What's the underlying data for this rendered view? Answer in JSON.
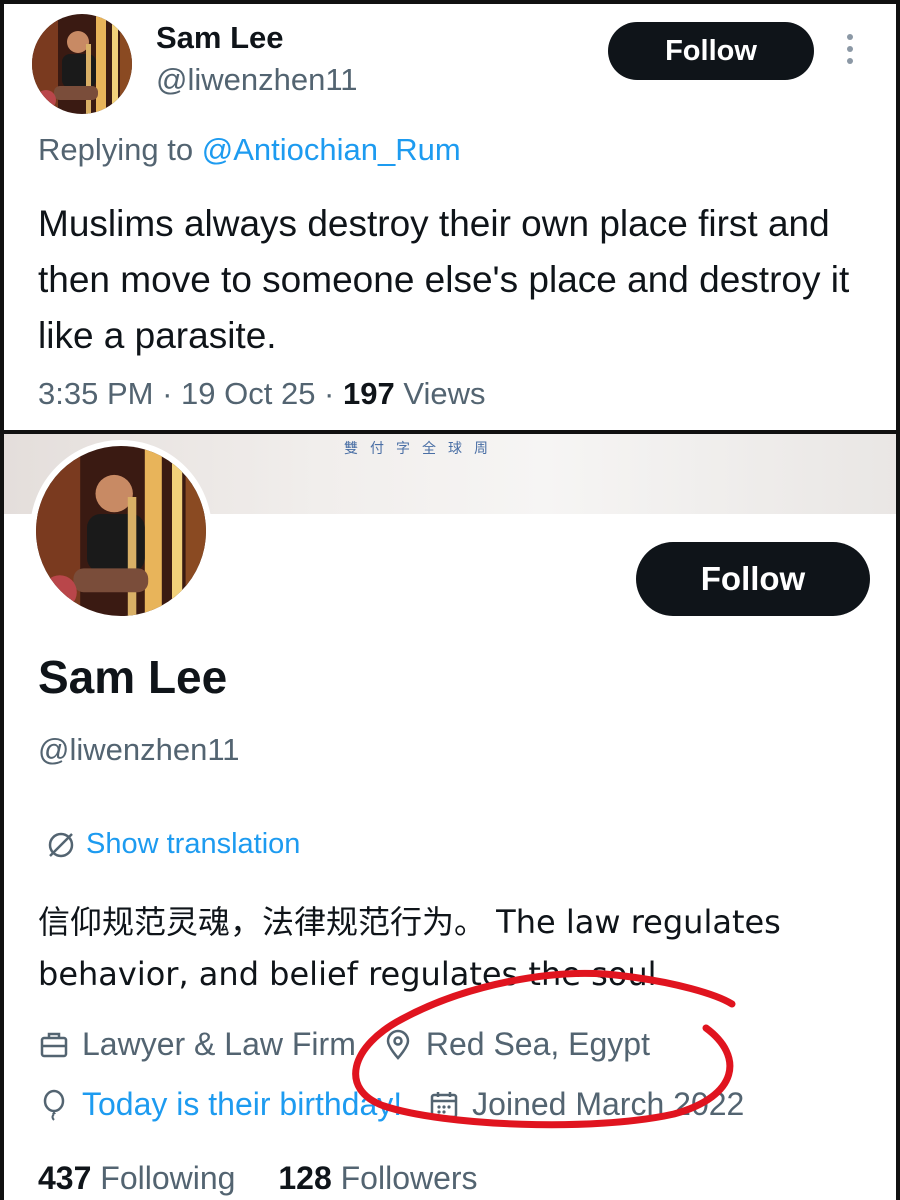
{
  "tweet": {
    "author_name": "Sam Lee",
    "author_handle": "@liwenzhen11",
    "follow_label": "Follow",
    "reply_prefix": "Replying to",
    "reply_mention": "@Antiochian_Rum",
    "text": "Muslims always destroy their own place first and then move to someone else's place and destroy it like a parasite.",
    "time": "3:35 PM",
    "separator": " · ",
    "date": "19 Oct 25",
    "views_count": "197",
    "views_label": "Views"
  },
  "profile": {
    "banner_text": "雙付字全球周",
    "name": "Sam Lee",
    "handle": "@liwenzhen11",
    "follow_label": "Follow",
    "show_translation": "Show translation",
    "bio": "信仰规范灵魂，法律规范行为。 The law regulates behavior, and belief regulates the soul.",
    "category": "Lawyer & Law Firm",
    "location": "Red Sea, Egypt",
    "birthday": "Today is their birthday!",
    "joined": "Joined March 2022",
    "following_count": "437",
    "following_label": "Following",
    "followers_count": "128",
    "followers_label": "Followers"
  },
  "icons": {
    "more": "more-vertical-icon",
    "translate": "translate-globe-icon",
    "category": "briefcase-icon",
    "location": "location-pin-icon",
    "birthday": "balloon-icon",
    "joined": "calendar-icon"
  },
  "colors": {
    "accent": "#1d9bf0",
    "secondary_text": "#536471",
    "follow_button": "#0f1419",
    "annotation_red": "#e0141f"
  }
}
